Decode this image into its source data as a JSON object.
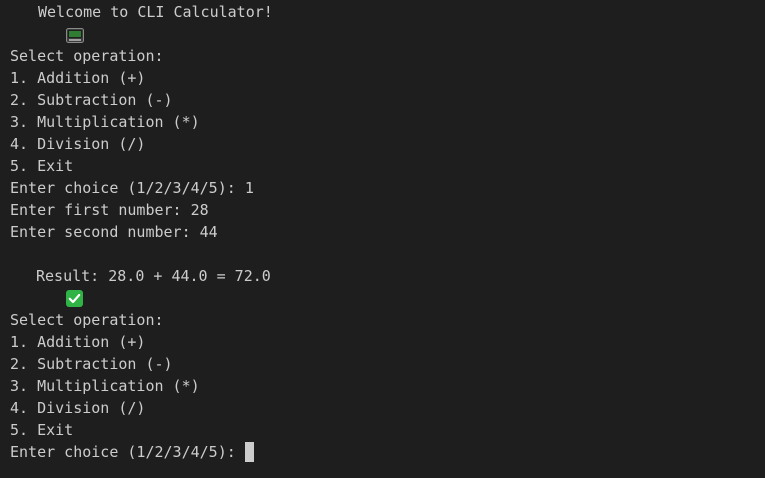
{
  "terminal": {
    "welcome": "Welcome to CLI Calculator!",
    "welcome_icon": "computer-icon",
    "menu_block_1": {
      "header": "Select operation:",
      "options": [
        "1. Addition (+)",
        "2. Subtraction (-)",
        "3. Multiplication (*)",
        "4. Division (/)",
        "5. Exit"
      ],
      "choice_prompt": "Enter choice (1/2/3/4/5): ",
      "choice_value": "1",
      "first_prompt": "Enter first number: ",
      "first_value": "28",
      "second_prompt": "Enter second number: ",
      "second_value": "44"
    },
    "result": {
      "icon": "check-mark-icon",
      "text": "Result: 28.0 + 44.0 = 72.0"
    },
    "menu_block_2": {
      "header": "Select operation:",
      "options": [
        "1. Addition (+)",
        "2. Subtraction (-)",
        "3. Multiplication (*)",
        "4. Division (/)",
        "5. Exit"
      ],
      "choice_prompt": "Enter choice (1/2/3/4/5): ",
      "choice_value": ""
    },
    "colors": {
      "background": "#1e1e1e",
      "foreground": "#cccccc",
      "check_green": "#2fb344"
    }
  }
}
